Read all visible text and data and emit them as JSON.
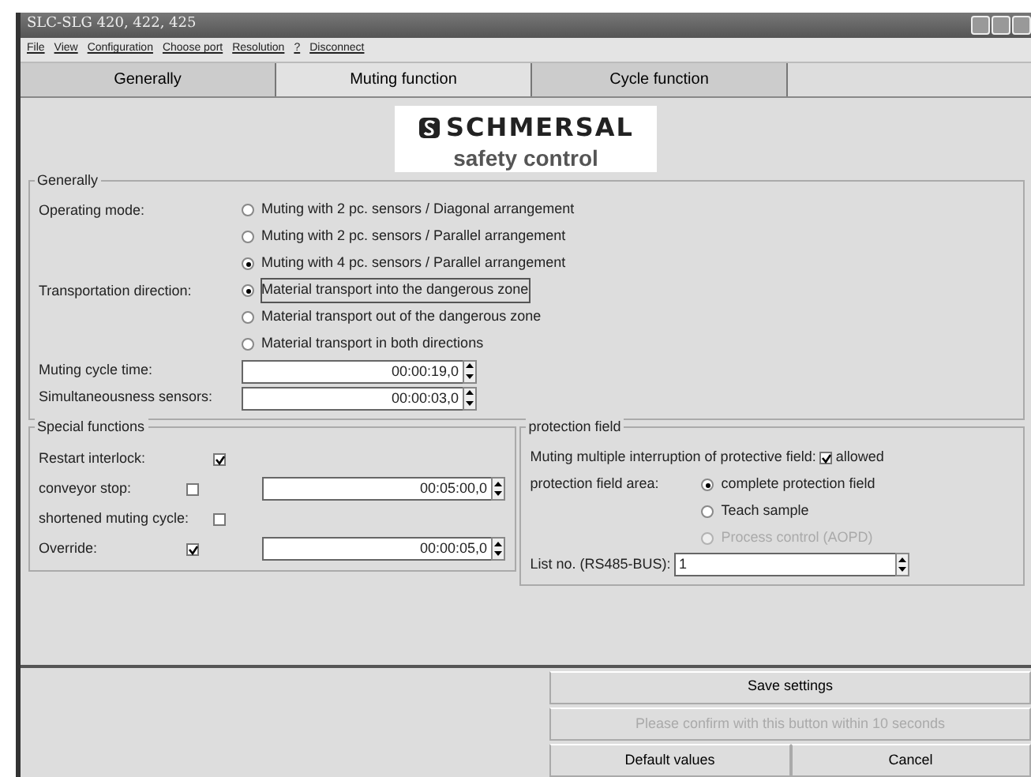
{
  "window": {
    "title": "SLC-SLG 420, 422, 425"
  },
  "menu": [
    {
      "label": "File"
    },
    {
      "label": "View"
    },
    {
      "label": "Configuration"
    },
    {
      "label": "Choose port"
    },
    {
      "label": "Resolution"
    },
    {
      "label": "?"
    },
    {
      "label": "Disconnect"
    }
  ],
  "tabs": [
    {
      "label": "Generally",
      "selected": false
    },
    {
      "label": "Muting function",
      "selected": true
    },
    {
      "label": "Cycle function",
      "selected": false
    }
  ],
  "logo": {
    "brand": "SCHMERSAL",
    "tagline": "safety control"
  },
  "generally": {
    "title": "Generally",
    "radio_groups": [
      {
        "label": "Operating mode:",
        "options": [
          {
            "label": "Muting with 2 pc. sensors / Diagonal arrangement",
            "selected": false
          },
          {
            "label": "Muting with 2 pc. sensors / Parallel arrangement",
            "selected": false
          },
          {
            "label": "Muting with 4 pc. sensors / Parallel arrangement",
            "selected": true
          }
        ]
      },
      {
        "label": "Transportation direction:",
        "options": [
          {
            "label": "Material transport into the dangerous zone",
            "selected": true
          },
          {
            "label": "Material transport out of the dangerous zone",
            "selected": false
          },
          {
            "label": "Material transport in both directions",
            "selected": false
          }
        ]
      }
    ],
    "spinners": [
      {
        "label": "Muting cycle time:",
        "value": "00:00:19,0"
      },
      {
        "label": "Simultaneousness sensors:",
        "value": "00:00:03,0"
      }
    ]
  },
  "special_functions": {
    "title": "Special functions",
    "rows": [
      {
        "label": "Restart interlock:",
        "checked": true
      },
      {
        "label": "conveyor stop:",
        "checked": false,
        "value": "00:05:00,0"
      },
      {
        "label": "shortened muting cycle:",
        "checked": false
      },
      {
        "label": "Override:",
        "checked": true,
        "value": "00:00:05,0"
      }
    ]
  },
  "protection_field": {
    "title": "protection field",
    "multiple_label": "Muting multiple interruption of protective field:",
    "multiple_checkbox": {
      "label": "allowed",
      "checked": true
    },
    "area_label": "protection field area:",
    "area_options": [
      {
        "label": "complete protection field",
        "selected": true,
        "disabled": false
      },
      {
        "label": "Teach sample",
        "selected": false,
        "disabled": false
      },
      {
        "label": "Process control (AOPD)",
        "selected": false,
        "disabled": true
      }
    ],
    "list_label": "List no. (RS485-BUS):",
    "list_value": "1"
  },
  "buttons": [
    {
      "label": "Save settings",
      "disabled": false
    },
    {
      "label": "Please confirm with this button within 10 seconds",
      "disabled": true
    },
    {
      "label": "Default values",
      "disabled": false
    },
    {
      "label": "Cancel",
      "disabled": false
    }
  ]
}
